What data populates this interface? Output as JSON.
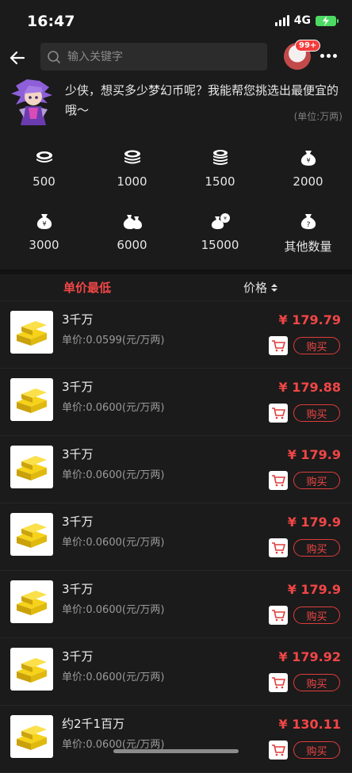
{
  "status_bar": {
    "time": "16:47",
    "network": "4G"
  },
  "nav": {
    "search_placeholder": "输入关键字",
    "badge": "99+"
  },
  "intro": {
    "message": "少侠，想买多少梦幻币呢？我能帮您挑选出最便宜的哦～",
    "unit_note": "(单位:万两)"
  },
  "quantities": [
    {
      "label": "500",
      "icon": "coin-stack-icon"
    },
    {
      "label": "1000",
      "icon": "coin-stack-icon"
    },
    {
      "label": "1500",
      "icon": "coin-stack-icon"
    },
    {
      "label": "2000",
      "icon": "money-bag-icon"
    },
    {
      "label": "3000",
      "icon": "money-bag-icon"
    },
    {
      "label": "6000",
      "icon": "money-bag-icon"
    },
    {
      "label": "15000",
      "icon": "money-bag-icon"
    },
    {
      "label": "其他数量",
      "icon": "money-bag-icon"
    }
  ],
  "sort": {
    "lowest_label": "单价最低",
    "price_label": "价格"
  },
  "buy_label": "购买",
  "listings": [
    {
      "title": "3千万",
      "unit_price": "单价:0.0599(元/万两)",
      "price": "¥ 179.79"
    },
    {
      "title": "3千万",
      "unit_price": "单价:0.0600(元/万两)",
      "price": "¥ 179.88"
    },
    {
      "title": "3千万",
      "unit_price": "单价:0.0600(元/万两)",
      "price": "¥ 179.9"
    },
    {
      "title": "3千万",
      "unit_price": "单价:0.0600(元/万两)",
      "price": "¥ 179.9"
    },
    {
      "title": "3千万",
      "unit_price": "单价:0.0600(元/万两)",
      "price": "¥ 179.9"
    },
    {
      "title": "3千万",
      "unit_price": "单价:0.0600(元/万两)",
      "price": "¥ 179.92"
    },
    {
      "title": "约2千1百万",
      "unit_price": "单价:0.0600(元/万两)",
      "price": "¥ 130.11"
    }
  ],
  "colors": {
    "accent_red": "#f24646",
    "background": "#1b1b1b"
  }
}
